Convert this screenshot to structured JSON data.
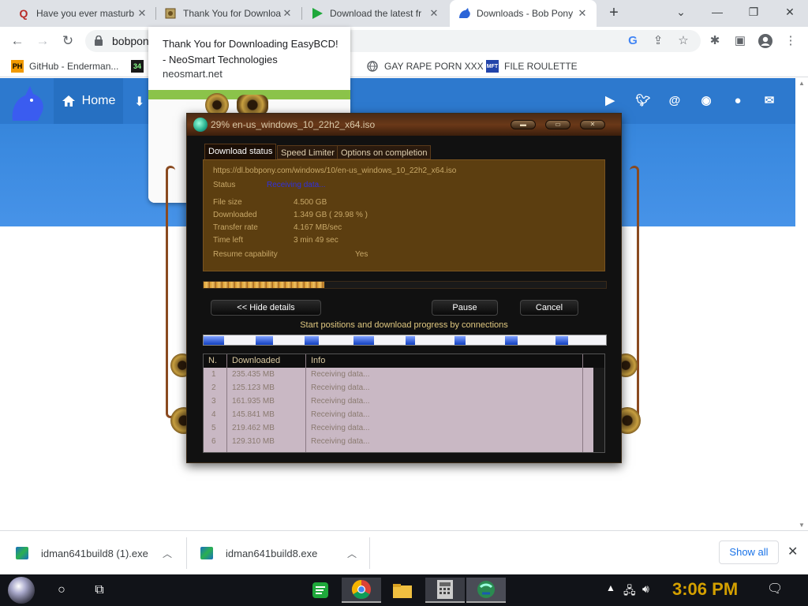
{
  "browser": {
    "tabs": [
      {
        "label": "Have you ever masturb",
        "icon": "quora-icon",
        "color": "#b92b27"
      },
      {
        "label": "Thank You for Downloa",
        "icon": "neosmart-icon"
      },
      {
        "label": "Download the latest fr",
        "icon": "play-triangle-icon",
        "color": "#1fa83b"
      },
      {
        "label": "Downloads - Bob Pony",
        "icon": "bob-pony-icon",
        "color": "#2a64d8",
        "active": true
      }
    ],
    "url": "bobpon",
    "bookmarks": [
      {
        "label": "GitHub - Enderman...",
        "icon": "ph-icon"
      },
      {
        "label": "GAY RAPE PORN XXX",
        "icon": "globe-icon"
      },
      {
        "label": "FILE ROULETTE",
        "icon": "mft-icon"
      }
    ]
  },
  "site": {
    "home_label": "Home"
  },
  "notification": {
    "title": "Thank You for Downloading EasyBCD! - NeoSmart Technologies",
    "domain": "neosmart.net"
  },
  "idm": {
    "title": "29% en-us_windows_10_22h2_x64.iso",
    "tabs": [
      "Download status",
      "Speed Limiter",
      "Options on completion"
    ],
    "url": "https://dl.bobpony.com/windows/10/en-us_windows_10_22h2_x64.iso",
    "status_label": "Status",
    "status_value": "Receiving data...",
    "fields": [
      {
        "label": "File size",
        "value": "4.500  GB"
      },
      {
        "label": "Downloaded",
        "value": "1.349  GB  ( 29.98 % )"
      },
      {
        "label": "Transfer rate",
        "value": "4.167  MB/sec"
      },
      {
        "label": "Time left",
        "value": "3 min 49 sec"
      }
    ],
    "resume_label": "Resume capability",
    "resume_value": "Yes",
    "progress": 0.2998,
    "buttons": {
      "hide_details": "<< Hide details",
      "pause": "Pause",
      "cancel": "Cancel"
    },
    "connections_caption": "Start positions and download progress by connections",
    "table_headers": [
      "N.",
      "Downloaded",
      "Info"
    ],
    "connections": [
      {
        "n": "1",
        "downloaded": "235.435  MB",
        "info": "Receiving data..."
      },
      {
        "n": "2",
        "downloaded": "125.123  MB",
        "info": "Receiving data..."
      },
      {
        "n": "3",
        "downloaded": "161.935  MB",
        "info": "Receiving data..."
      },
      {
        "n": "4",
        "downloaded": "145.841  MB",
        "info": "Receiving data..."
      },
      {
        "n": "5",
        "downloaded": "219.462  MB",
        "info": "Receiving data..."
      },
      {
        "n": "6",
        "downloaded": "129.310  MB",
        "info": "Receiving data..."
      }
    ]
  },
  "downloads_bar": {
    "items": [
      "idman641build8 (1).exe",
      "idman641build8.exe"
    ],
    "show_all": "Show all"
  },
  "taskbar": {
    "clock": "3:06 PM"
  }
}
